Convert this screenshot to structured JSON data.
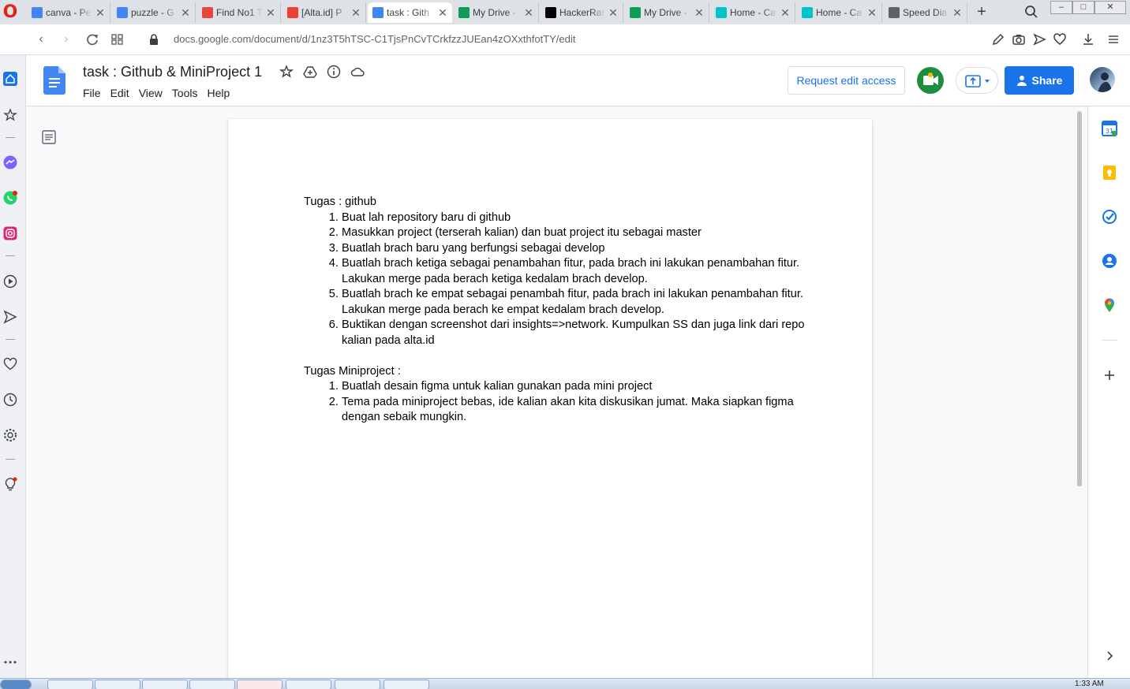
{
  "browser": {
    "tabs": [
      {
        "title": "canva - Pe",
        "favicon": "google-icon",
        "color": "#4285f4"
      },
      {
        "title": "puzzle - G",
        "favicon": "google-icon",
        "color": "#4285f4"
      },
      {
        "title": "Find No1 T",
        "favicon": "umbrella-icon",
        "color": "#e8453c"
      },
      {
        "title": "[Alta.id] P",
        "favicon": "gmail-icon",
        "color": "#ea4335"
      },
      {
        "title": "task : Gith",
        "favicon": "docs-icon",
        "color": "#4285f4"
      },
      {
        "title": "My Drive -",
        "favicon": "drive-icon",
        "color": "#0f9d58"
      },
      {
        "title": "HackerRan",
        "favicon": "hackerrank-icon",
        "color": "#000000"
      },
      {
        "title": "My Drive -",
        "favicon": "drive-icon",
        "color": "#0f9d58"
      },
      {
        "title": "Home - Ca",
        "favicon": "canva-icon",
        "color": "#00c4cc"
      },
      {
        "title": "Home - Ca",
        "favicon": "canva-icon",
        "color": "#00c4cc"
      },
      {
        "title": "Speed Dia",
        "favicon": "speed-dial-icon",
        "color": "#5f6368"
      }
    ],
    "new_tab": "+",
    "url": "docs.google.com/document/d/1nz3T5hTSC-C1TjsPnCvTCrkfzzJUEan4zOXxthfotTY/edit"
  },
  "docs": {
    "title": "task : Github & MiniProject 1",
    "menu": [
      "File",
      "Edit",
      "View",
      "Tools",
      "Help"
    ],
    "request_edit_label": "Request edit access",
    "share_label": "Share"
  },
  "document": {
    "sections": [
      {
        "heading": "Tugas : github",
        "items": [
          "Buat lah repository baru di github",
          "Masukkan project (terserah kalian) dan buat project itu sebagai master",
          "Buatlah brach baru yang berfungsi sebagai develop",
          "Buatlah brach ketiga sebagai penambahan fitur, pada brach ini lakukan penambahan fitur. Lakukan merge pada berach ketiga kedalam brach develop.",
          "Buatlah brach ke empat sebagai penambah fitur, pada brach ini lakukan penambahan fitur. Lakukan merge pada berach ke empat kedalam brach develop.",
          "Buktikan dengan screenshot dari insights=>network. Kumpulkan SS dan juga link dari repo kalian pada alta.id"
        ]
      },
      {
        "heading": "Tugas Miniproject :",
        "items": [
          "Buatlah desain figma untuk kalian gunakan pada mini project",
          "Tema pada miniproject bebas, ide kalian akan kita diskusikan jumat. Maka siapkan figma dengan sebaik mungkin."
        ]
      }
    ]
  },
  "colors": {
    "accent": "#1a73e8",
    "opera_red": "#e2231a"
  },
  "taskbar": {
    "clock": "1:33 AM"
  }
}
